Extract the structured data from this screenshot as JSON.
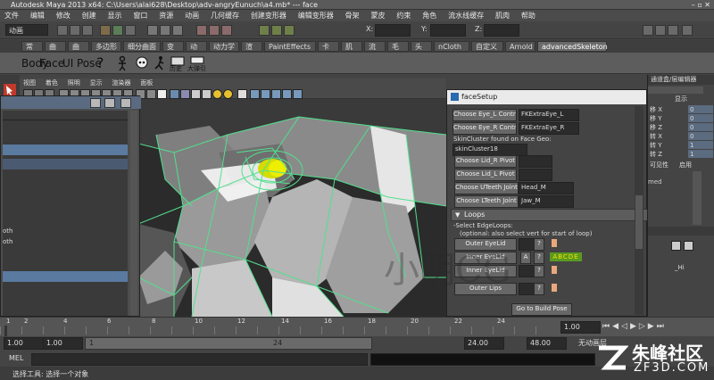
{
  "window": {
    "title": "Autodesk Maya 2013 x64: C:\\Users\\alai628\\Desktop\\adv-angryEunuch\\a4.mb*   ---   face",
    "controls": "– ▫ ✕"
  },
  "menubar": [
    "文件",
    "编辑",
    "修改",
    "创建",
    "显示",
    "窗口",
    "资源",
    "动画",
    "几何缓存",
    "创建变形器",
    "编辑变形器",
    "骨架",
    "蒙皮",
    "约束",
    "角色",
    "流水线缓存",
    "肌肉",
    "帮助"
  ],
  "statusline": {
    "mode": "动画",
    "x_label": "X:",
    "y_label": "Y:",
    "z_label": "Z:"
  },
  "shelf_tabs": [
    "常规",
    "曲线",
    "曲面",
    "多边形",
    "细分曲面",
    "变形",
    "动画",
    "动力学",
    "渲染",
    "PaintEffects",
    "卡通",
    "肌肉",
    "流体",
    "毛发",
    "头发",
    "nCloth",
    "自定义",
    "Arnold",
    "advancedSkeleton"
  ],
  "shelf_tab_active": "advancedSkeleton",
  "shelf_buttons": {
    "body": "Body",
    "face": "Face",
    "ui": "UI",
    "pose": "Pose",
    "history": "历史",
    "magnet": "大弹引"
  },
  "panel_menu": [
    "视图",
    "着色",
    "照明",
    "显示",
    "渲染器",
    "面板"
  ],
  "channel_header": "通道盒/层编辑器",
  "channel_display": "显示",
  "channel_rows": [
    {
      "label": "移 X",
      "value": "0"
    },
    {
      "label": "移 Y",
      "value": "0"
    },
    {
      "label": "移 Z",
      "value": "0"
    },
    {
      "label": "转 X",
      "value": "0"
    },
    {
      "label": "转 Y",
      "value": "1"
    },
    {
      "label": "转 Z",
      "value": "1"
    },
    {
      "label": "可见性",
      "value": "启用"
    }
  ],
  "right_extra": {
    "med": "med",
    "hi": "_Hi"
  },
  "outliner": {
    "rows": [
      "oth",
      "oth"
    ]
  },
  "facesetup": {
    "title": "faceSetup",
    "rows": [
      {
        "button": "Choose Eye_L Control",
        "value": "FKExtraEye_L"
      },
      {
        "button": "Choose Eye_R Control",
        "value": "FKExtraEye_R"
      }
    ],
    "skin_label": "SkinCluster found on Face Geo:",
    "skin_value": "skinCluster18",
    "pivot_buttons": [
      "Choose Lid_R Pivot",
      "Choose Lid_L Pivot"
    ],
    "joint_rows": [
      {
        "button": "Choose UTeeth Joint",
        "value": "Head_M"
      },
      {
        "button": "Choose LTeeth Joint",
        "value": "Jaw_M"
      }
    ],
    "section": "Loops",
    "edge_label": "-Select EdgeLoops:",
    "edge_hint": "(optional: also select vert for start of loop)",
    "loop_buttons": [
      "Outer EyeLid",
      "Inner EyeLid",
      "Inner EyeLid",
      "Outer Lips"
    ],
    "q": "?",
    "a_btn": "A",
    "abcde": "ABCDE",
    "build_btn": "Go to Build Pose"
  },
  "timeline": {
    "ticks": [
      "1",
      "2",
      "4",
      "6",
      "8",
      "10",
      "12",
      "14",
      "16",
      "18",
      "20",
      "22",
      "24"
    ],
    "current": "1.00"
  },
  "range": {
    "start": "1.00",
    "start2": "1.00",
    "current": "1",
    "end_inner": "24",
    "end": "24.00",
    "end2": "48.00",
    "anim_layer": "无动画层"
  },
  "command": {
    "label": "MEL"
  },
  "helpline": "选择工具: 选择一个对象",
  "watermark": {
    "cn": "朱峰社区",
    "url": "ZF3D.COM",
    "stamp": "小明CG"
  },
  "colors": {
    "accent": "#5a6a80",
    "eye": "#d9e000",
    "wire": "#52e08e"
  }
}
